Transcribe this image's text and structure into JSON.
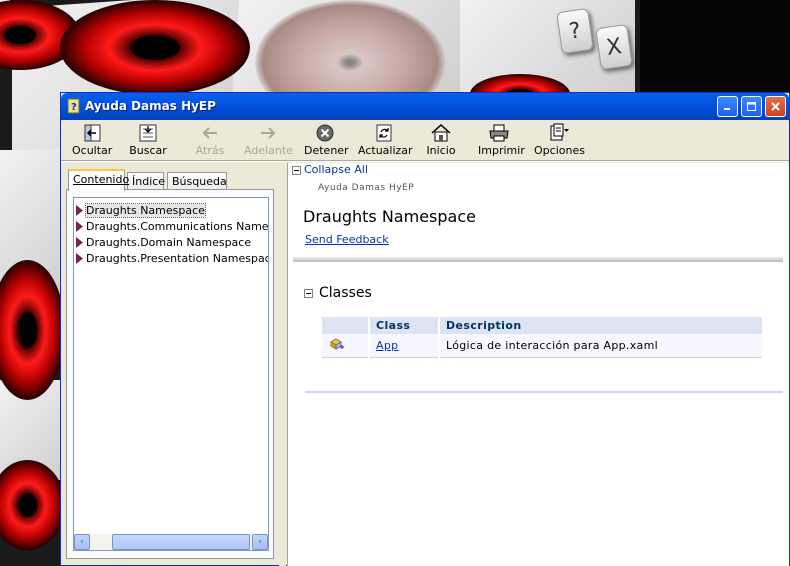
{
  "game": {
    "help_button_label": "?",
    "close_button_label": "X"
  },
  "window": {
    "title": "Ayuda Damas HyEP",
    "controls": {
      "minimize": "minimize",
      "maximize": "maximize",
      "close": "close"
    }
  },
  "toolbar": {
    "buttons": [
      {
        "label": "Ocultar",
        "icon": "hide-pane-icon",
        "enabled": true
      },
      {
        "label": "Buscar",
        "icon": "locate-icon",
        "enabled": true
      },
      {
        "label": "Atrás",
        "icon": "back-arrow-icon",
        "enabled": false
      },
      {
        "label": "Adelante",
        "icon": "forward-arrow-icon",
        "enabled": false
      },
      {
        "label": "Detener",
        "icon": "stop-icon",
        "enabled": true
      },
      {
        "label": "Actualizar",
        "icon": "refresh-icon",
        "enabled": true
      },
      {
        "label": "Inicio",
        "icon": "home-icon",
        "enabled": true
      },
      {
        "label": "Imprimir",
        "icon": "printer-icon",
        "enabled": true
      },
      {
        "label": "Opciones",
        "icon": "options-icon",
        "enabled": true
      }
    ]
  },
  "nav": {
    "tabs": [
      {
        "label": "Contenido",
        "active": true
      },
      {
        "label": "Índice",
        "active": false
      },
      {
        "label": "Búsqueda",
        "active": false
      }
    ],
    "tree": [
      {
        "label": "Draughts Namespace",
        "selected": true
      },
      {
        "label": "Draughts.Communications Namespace",
        "selected": false
      },
      {
        "label": "Draughts.Domain Namespace",
        "selected": false
      },
      {
        "label": "Draughts.Presentation Namespace",
        "selected": false
      }
    ],
    "scroll_left": "‹",
    "scroll_right": "›"
  },
  "content": {
    "collapse_all": "Collapse All",
    "breadcrumb": "Ayuda Damas HyEP",
    "heading": "Draughts Namespace",
    "feedback_link": "Send Feedback",
    "section_title": "Classes",
    "table": {
      "headers": [
        "",
        "Class",
        "Description"
      ],
      "rows": [
        {
          "icon": "class-icon",
          "class": "App",
          "description": "Lógica de interacción para App.xaml"
        }
      ]
    }
  }
}
